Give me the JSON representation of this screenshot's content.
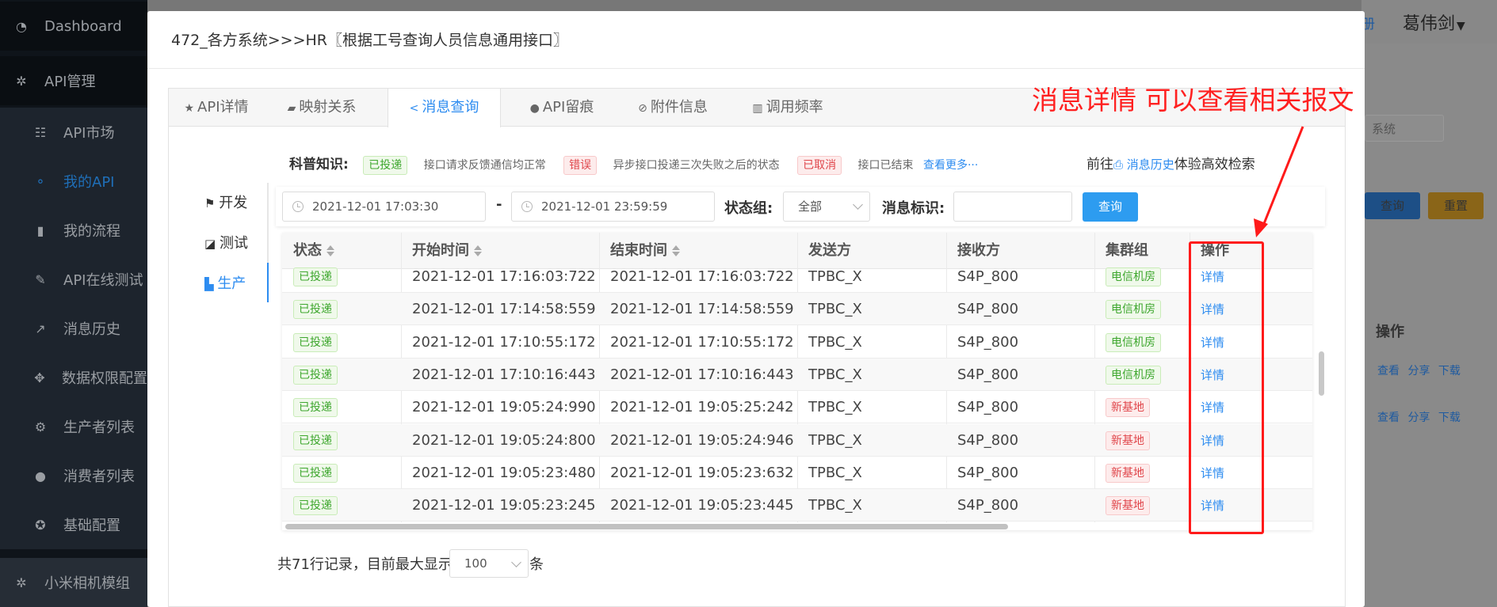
{
  "sidebar": {
    "dashboard": "Dashboard",
    "api_manage": "API管理",
    "items": [
      {
        "label": "API市场",
        "icon": "list-icon"
      },
      {
        "label": "我的API",
        "icon": "sitemap-icon"
      },
      {
        "label": "我的流程",
        "icon": "book-icon"
      },
      {
        "label": "API在线测试",
        "icon": "edit-icon"
      },
      {
        "label": "消息历史",
        "icon": "external-link-icon"
      },
      {
        "label": "数据权限配置",
        "icon": "move-icon"
      },
      {
        "label": "生产者列表",
        "icon": "settings-icon"
      },
      {
        "label": "消费者列表",
        "icon": "user-icon"
      },
      {
        "label": "基础配置",
        "icon": "gear-icon"
      }
    ],
    "bottom": "小米相机模组"
  },
  "background": {
    "register": "册",
    "user": "葛伟剑",
    "search_placeholder": "系统",
    "query": "查询",
    "reset": "重置",
    "op_header": "操作",
    "row_links": [
      "查看",
      "分享",
      "下载"
    ]
  },
  "modal": {
    "title": "472_各方系统>>>HR〖根据工号查询人员信息通用接口〗",
    "tabs": [
      {
        "label": "API详情",
        "icon": "★"
      },
      {
        "label": "映射关系",
        "icon": "▰"
      },
      {
        "label": "消息查询",
        "icon": "<"
      },
      {
        "label": "API留痕",
        "icon": "●"
      },
      {
        "label": "附件信息",
        "icon": "⊘"
      },
      {
        "label": "调用频率",
        "icon": "▥"
      }
    ]
  },
  "knowledge": {
    "label": "科普知识:",
    "tag1": "已投递",
    "desc1": "接口请求反馈通信均正常",
    "tag2": "错误",
    "desc2": "异步接口投递三次失败之后的状态",
    "tag3": "已取消",
    "desc3": "接口已结束",
    "more": "查看更多···",
    "goto_prefix": "前往",
    "goto_link": "消息历史",
    "goto_suffix": "体验高效检索"
  },
  "env": {
    "dev": "开发",
    "test": "测试",
    "prod": "生产"
  },
  "filter": {
    "start": "2021-12-01 17:03:30",
    "dash": "-",
    "end": "2021-12-01 23:59:59",
    "status_label": "状态组:",
    "status_value": "全部",
    "msg_label": "消息标识:",
    "msg_value": "",
    "query": "查询"
  },
  "table": {
    "headers": [
      "状态",
      "开始时间",
      "结束时间",
      "发送方",
      "接收方",
      "集群组",
      "操作"
    ],
    "rows": [
      {
        "status": "已投递",
        "start": "2021-12-01 17:16:03:722",
        "end": "2021-12-01 17:16:03:722",
        "sender": "TPBC_X",
        "receiver": "S4P_800",
        "cluster": "电信机房",
        "cluster_color": "green",
        "op": "详情"
      },
      {
        "status": "已投递",
        "start": "2021-12-01 17:14:58:559",
        "end": "2021-12-01 17:14:58:559",
        "sender": "TPBC_X",
        "receiver": "S4P_800",
        "cluster": "电信机房",
        "cluster_color": "green",
        "op": "详情"
      },
      {
        "status": "已投递",
        "start": "2021-12-01 17:10:55:172",
        "end": "2021-12-01 17:10:55:172",
        "sender": "TPBC_X",
        "receiver": "S4P_800",
        "cluster": "电信机房",
        "cluster_color": "green",
        "op": "详情"
      },
      {
        "status": "已投递",
        "start": "2021-12-01 17:10:16:443",
        "end": "2021-12-01 17:10:16:443",
        "sender": "TPBC_X",
        "receiver": "S4P_800",
        "cluster": "电信机房",
        "cluster_color": "green",
        "op": "详情"
      },
      {
        "status": "已投递",
        "start": "2021-12-01 19:05:24:990",
        "end": "2021-12-01 19:05:25:242",
        "sender": "TPBC_X",
        "receiver": "S4P_800",
        "cluster": "新基地",
        "cluster_color": "red",
        "op": "详情"
      },
      {
        "status": "已投递",
        "start": "2021-12-01 19:05:24:800",
        "end": "2021-12-01 19:05:24:946",
        "sender": "TPBC_X",
        "receiver": "S4P_800",
        "cluster": "新基地",
        "cluster_color": "red",
        "op": "详情"
      },
      {
        "status": "已投递",
        "start": "2021-12-01 19:05:23:480",
        "end": "2021-12-01 19:05:23:632",
        "sender": "TPBC_X",
        "receiver": "S4P_800",
        "cluster": "新基地",
        "cluster_color": "red",
        "op": "详情"
      },
      {
        "status": "已投递",
        "start": "2021-12-01 19:05:23:245",
        "end": "2021-12-01 19:05:23:445",
        "sender": "TPBC_X",
        "receiver": "S4P_800",
        "cluster": "新基地",
        "cluster_color": "red",
        "op": "详情"
      }
    ]
  },
  "footer": {
    "records": "共71行记录，目前最大显示",
    "page_size": "100",
    "unit": "条"
  },
  "annotation": {
    "text": "消息详情 可以查看相关报文",
    "color": "#ff2020"
  }
}
